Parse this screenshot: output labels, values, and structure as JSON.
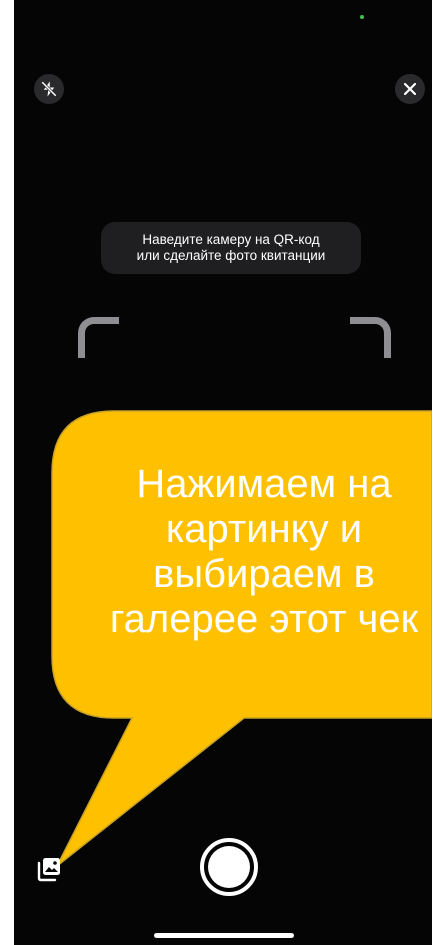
{
  "scanner": {
    "hint_line1": "Наведите камеру на QR-код",
    "hint_line2": "или сделайте фото квитанции"
  },
  "icons": {
    "flash": "flash-off-icon",
    "close": "close-icon",
    "gallery": "gallery-icon"
  },
  "callout": {
    "line1": "Нажимаем на",
    "line2": "картинку и",
    "line3": "выбираем в",
    "line4": "галерее этот чек",
    "color": "#FFC000",
    "border_color": "#C9A227"
  }
}
